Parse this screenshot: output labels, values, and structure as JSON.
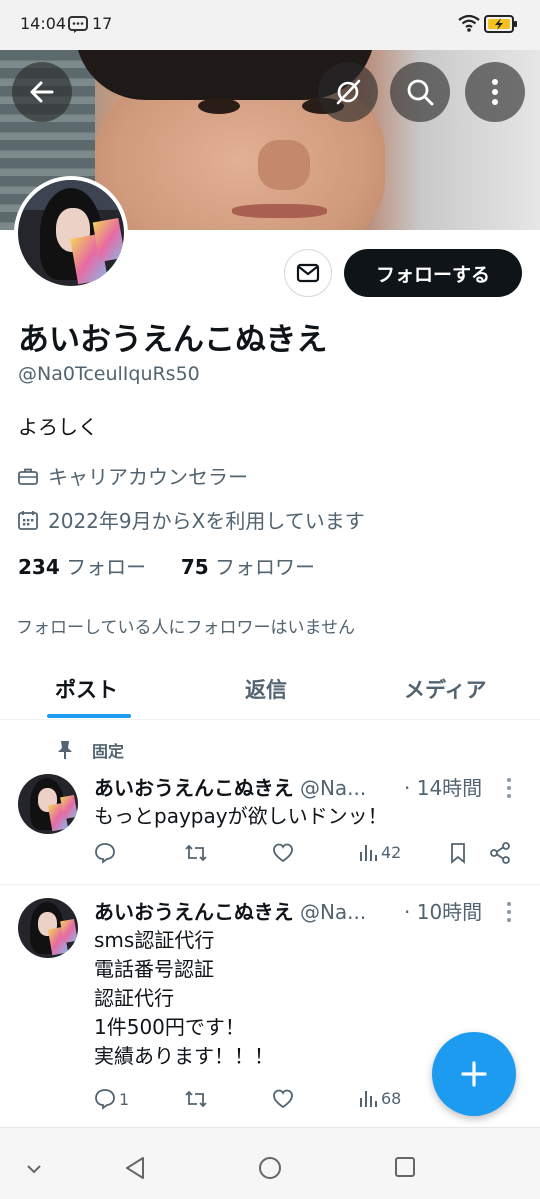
{
  "status_bar": {
    "time": "14:04",
    "notification_count": "17"
  },
  "profile": {
    "display_name": "あいおうえんこぬきえ",
    "handle": "@Na0TceulIquRs50",
    "bio": "よろしく",
    "job": "キャリアカウンセラー",
    "joined": "2022年9月からXを利用しています",
    "following_count": "234",
    "following_label": "フォロー",
    "followers_count": "75",
    "followers_label": "フォロワー",
    "no_mutual": "フォローしている人にフォロワーはいません",
    "follow_button": "フォローする"
  },
  "tabs": [
    {
      "label": "ポスト",
      "active": true
    },
    {
      "label": "返信",
      "active": false
    },
    {
      "label": "メディア",
      "active": false
    }
  ],
  "pinned_label": "固定",
  "posts": [
    {
      "name": "あいおうえんこぬきえ",
      "handle": "@Na...",
      "time": "· 14時間",
      "lines": [
        "もっとpaypayが欲しいドンッ！"
      ],
      "replies": "",
      "views": "42"
    },
    {
      "name": "あいおうえんこぬきえ",
      "handle": "@Na...",
      "time": "· 10時間",
      "lines": [
        "sms認証代行",
        "電話番号認証",
        "認証代行",
        "1件500円です！",
        "実績あります！！！"
      ],
      "replies": "1",
      "views": "68"
    }
  ],
  "colors": {
    "accent": "#1d9bf0",
    "text": "#0f1419",
    "secondary": "#536471",
    "button_dark": "#0f1419"
  }
}
